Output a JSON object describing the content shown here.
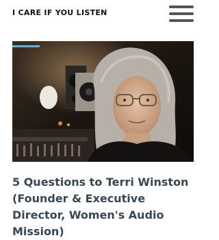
{
  "header": {
    "site_title": "I CARE IF YOU LISTEN",
    "menu_icon": "hamburger-menu-icon"
  },
  "article": {
    "image_subject": "portrait-photo",
    "headline": "5 Questions to Terri Winston (Founder & Executive Director, Women's Audio Mission)"
  },
  "colors": {
    "title_text": "#111111",
    "menu_icon": "#555555",
    "headline_text": "#3a4650"
  }
}
